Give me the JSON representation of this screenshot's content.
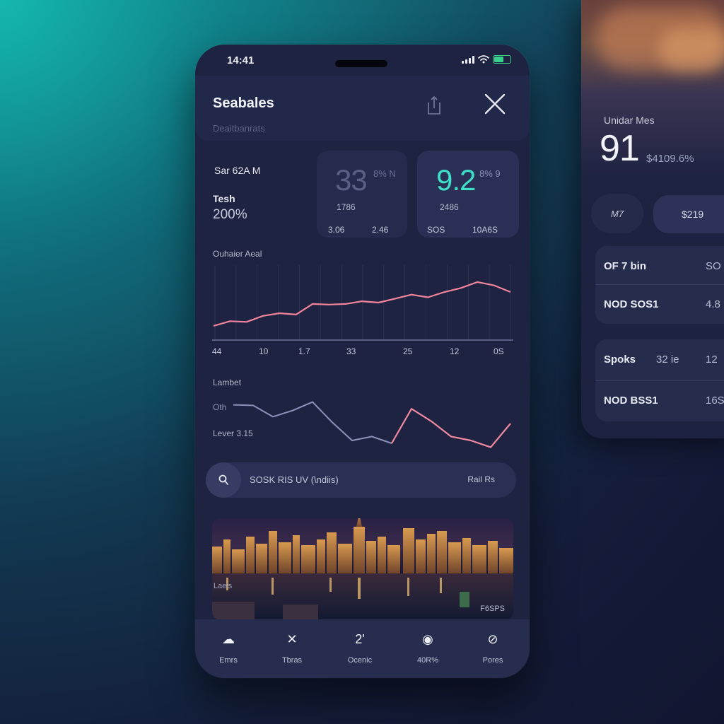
{
  "side_panel": {
    "label": "Unidar Mes",
    "big_value": "91",
    "small_value": "$4109.6%",
    "chip_round": "M7",
    "chip": "$219",
    "rows": [
      {
        "name": "OF 7 bin",
        "v1": "",
        "v2": "SO"
      },
      {
        "name": "NOD SOS1",
        "v1": "",
        "v2": "4.8"
      },
      {
        "name": "Spoks",
        "v1": "32 ie",
        "v2": "12"
      },
      {
        "name": "NOD BSS1",
        "v1": "",
        "v2": "16S"
      }
    ]
  },
  "status": {
    "time": "14:41"
  },
  "header": {
    "title": "Seabales",
    "subtitle": "Deaitbanrats"
  },
  "stats": {
    "s1_label": "Sar 62A M",
    "s1_label2": "Tesh",
    "s1_value": "200%",
    "s2_big": "33",
    "s2_unit": "8% N",
    "s2_sub": "1786",
    "s2_foot_a": "3.06",
    "s2_foot_b": "2.46",
    "s3_big": "9.2",
    "s3_unit": "8% 9",
    "s3_sub": "2486",
    "s3_foot_a": "SOS",
    "s3_foot_b": "10A6S"
  },
  "chart1": {
    "title": "Ouhaier Aeal",
    "tick_labels": [
      "44",
      "10",
      "1.7",
      "33",
      "25",
      "12",
      "0S"
    ],
    "accent": "#f2849c"
  },
  "chart2": {
    "label_top": "Lambet",
    "label_mid": "Oth",
    "label_bottom": "Lever 3.15"
  },
  "chart_data": [
    {
      "type": "line",
      "title": "Ouhaier Aeal",
      "categories": [
        "44",
        "10",
        "1.7",
        "33",
        "25",
        "12",
        "0S"
      ],
      "series": [
        {
          "values": [
            15,
            22,
            34,
            48,
            56,
            66,
            81
          ]
        }
      ],
      "ylim": [
        0,
        100
      ],
      "grid": true
    },
    {
      "type": "line",
      "title": "Lambet",
      "series": [
        {
          "values": [
            73,
            72,
            52,
            63,
            78,
            42,
            10,
            17,
            5,
            66,
            44,
            17,
            10,
            -2,
            40
          ]
        }
      ],
      "ylim": [
        -10,
        90
      ],
      "grid": false
    }
  ],
  "search": {
    "text": "SOSK RIS UV (\\ndiis)",
    "right": "Rail Rs"
  },
  "city": {
    "caption": "Laeis",
    "tag": "F6SPS"
  },
  "tabs": [
    {
      "icon": "cloud-icon",
      "glyph": "☁",
      "label": "Emrs"
    },
    {
      "icon": "tools-icon",
      "glyph": "✕",
      "label": "Tbras"
    },
    {
      "icon": "number-icon",
      "glyph": "2'",
      "label": "Ocenic"
    },
    {
      "icon": "headset-icon",
      "glyph": "◉",
      "label": "40R%"
    },
    {
      "icon": "lock-icon",
      "glyph": "⊘",
      "label": "Pores"
    }
  ]
}
